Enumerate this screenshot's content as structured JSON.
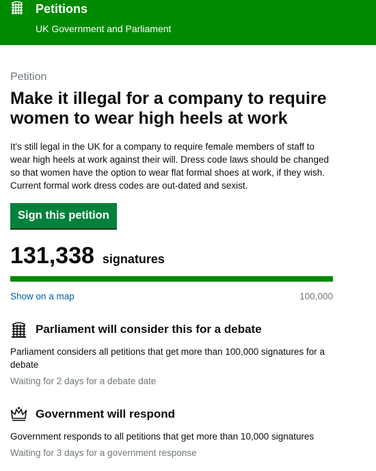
{
  "header": {
    "title": "Petitions",
    "subtitle": "UK Government and Parliament"
  },
  "petition": {
    "caption": "Petition",
    "title": "Make it illegal for a company to require women to wear high heels at work",
    "description": "It's still legal in the UK for a company to require female members of staff to wear high heels at work against their will. Dress code laws should be changed so that women have the option to wear flat formal shoes at work, if they wish. Current formal work dress codes are out-dated and sexist.",
    "sign_label": "Sign this petition"
  },
  "signatures": {
    "count": "131,338",
    "label": "signatures",
    "progress_fraction": 1.0,
    "show_map_label": "Show on a map",
    "threshold": "100,000"
  },
  "parliament": {
    "icon": "portcullis-icon",
    "heading": "Parliament will consider this for a debate",
    "text": "Parliament considers all petitions that get more than 100,000 signatures for a debate",
    "status": "Waiting for 2 days for a debate date"
  },
  "government": {
    "icon": "crown-icon",
    "heading": "Government will respond",
    "text": "Government responds to all petitions that get more than 10,000 signatures",
    "status": "Waiting for 3 days for a government response"
  },
  "colors": {
    "header": "#008a00",
    "button": "#00823b",
    "progress": "#008a00",
    "link": "#005ea5",
    "muted": "#6f777b"
  }
}
